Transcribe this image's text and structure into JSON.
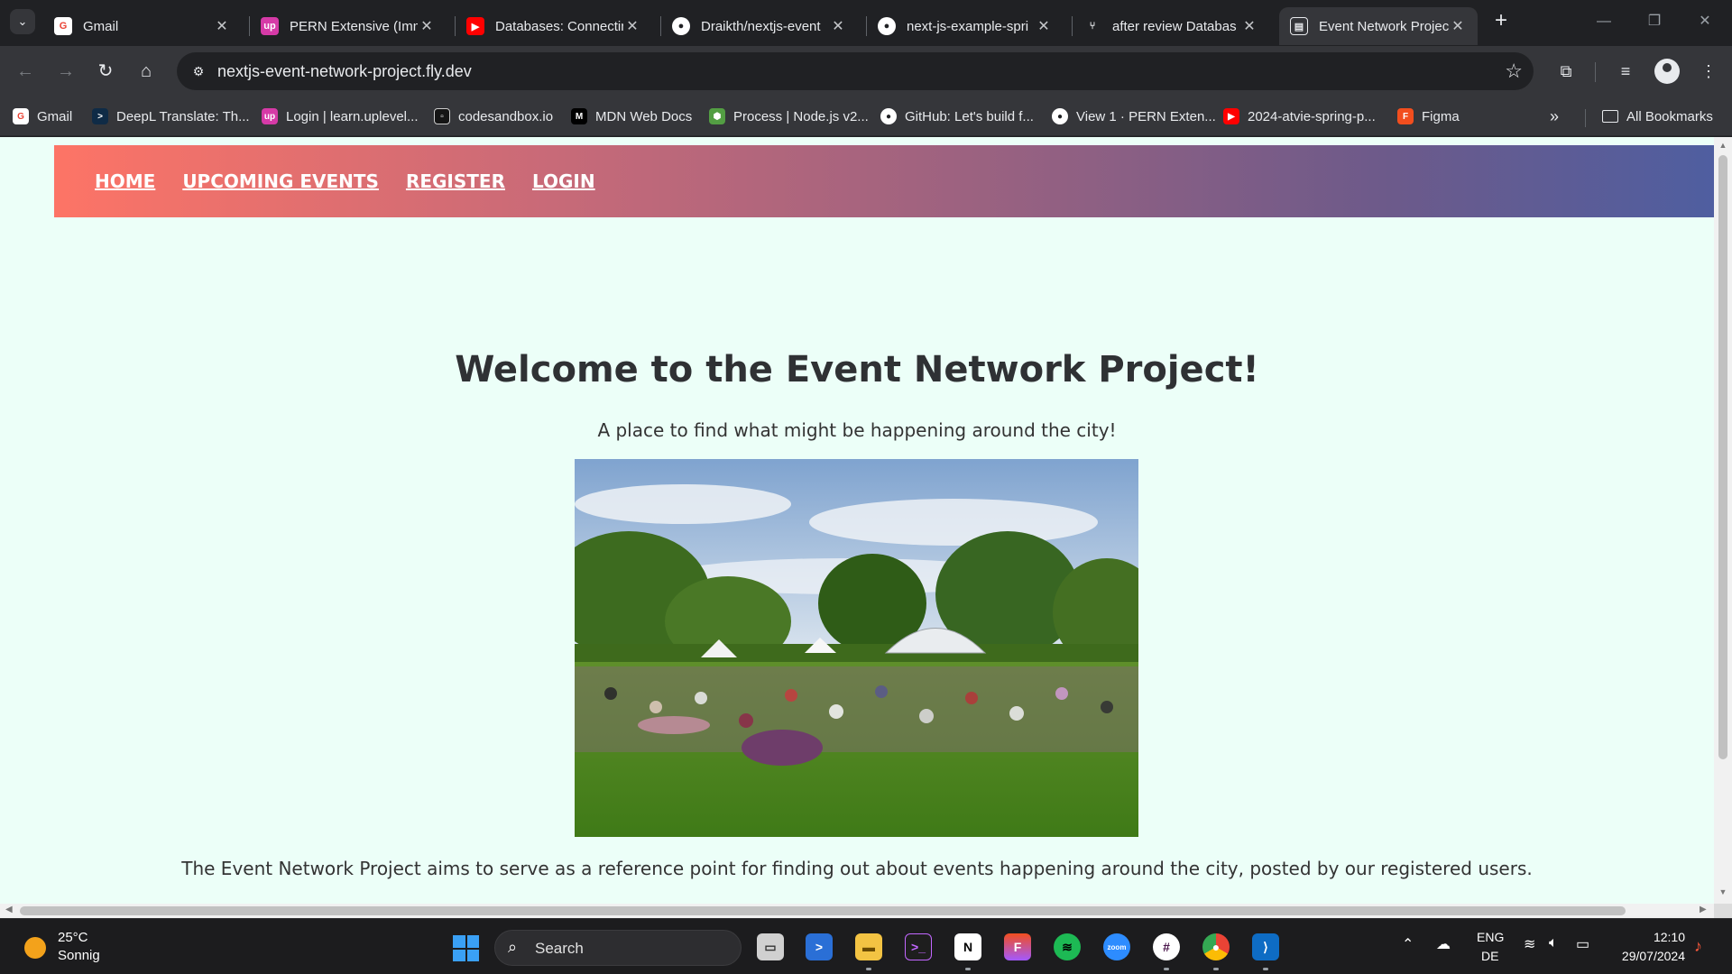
{
  "browser": {
    "tabs": [
      {
        "title": "Gmail",
        "icon": "gmail-icon",
        "color": "#ffffff"
      },
      {
        "title": "PERN Extensive (Imm",
        "icon": "uplevel-icon",
        "color": "#d63aa7"
      },
      {
        "title": "Databases: Connectin",
        "icon": "youtube-icon",
        "color": "#ff0000"
      },
      {
        "title": "Draikth/nextjs-event",
        "icon": "github-icon",
        "color": "#ffffff"
      },
      {
        "title": "next-js-example-spri",
        "icon": "github-icon",
        "color": "#ffffff"
      },
      {
        "title": "after review Databas",
        "icon": "git-pr-icon",
        "color": "#ffffff"
      },
      {
        "title": "Event Network Projec",
        "icon": "page-icon",
        "color": "#ffffff"
      }
    ],
    "url": "nextjs-event-network-project.fly.dev",
    "bookmarks": [
      {
        "label": "Gmail",
        "icon": "gmail-icon",
        "color": "#ffffff"
      },
      {
        "label": "DeepL Translate: Th...",
        "icon": "deepl-icon",
        "color": "#0f2b46"
      },
      {
        "label": "Login | learn.uplevel...",
        "icon": "uplevel-icon",
        "color": "#d63aa7"
      },
      {
        "label": "codesandbox.io",
        "icon": "codesandbox-icon",
        "color": "#151515"
      },
      {
        "label": "MDN Web Docs",
        "icon": "mdn-icon",
        "color": "#000000"
      },
      {
        "label": "Process | Node.js v2...",
        "icon": "nodejs-icon",
        "color": "#539e43"
      },
      {
        "label": "GitHub: Let's build f...",
        "icon": "github-icon",
        "color": "#ffffff"
      },
      {
        "label": "View 1 · PERN Exten...",
        "icon": "github-icon",
        "color": "#ffffff"
      },
      {
        "label": "2024-atvie-spring-p...",
        "icon": "youtube-icon",
        "color": "#ff0000"
      },
      {
        "label": "Figma",
        "icon": "figma-icon",
        "color": "#f24e1e"
      }
    ],
    "all_bookmarks": "All Bookmarks"
  },
  "page": {
    "nav": [
      "HOME",
      "UPCOMING EVENTS",
      "REGISTER",
      "LOGIN"
    ],
    "title": "Welcome to the Event Network Project!",
    "subtitle": "A place to find what might be happening around the city!",
    "description": "The Event Network Project aims to serve as a reference point for finding out about events happening around the city, posted by our registered users.",
    "nav_gradient": [
      "#fd7466",
      "#4f5ea0"
    ],
    "background": "#ecfff8"
  },
  "taskbar": {
    "weather_temp": "25°C",
    "weather_desc": "Sonnig",
    "search_placeholder": "Search",
    "lang_line1": "ENG",
    "lang_line2": "DE",
    "time": "12:10",
    "date": "29/07/2024"
  }
}
